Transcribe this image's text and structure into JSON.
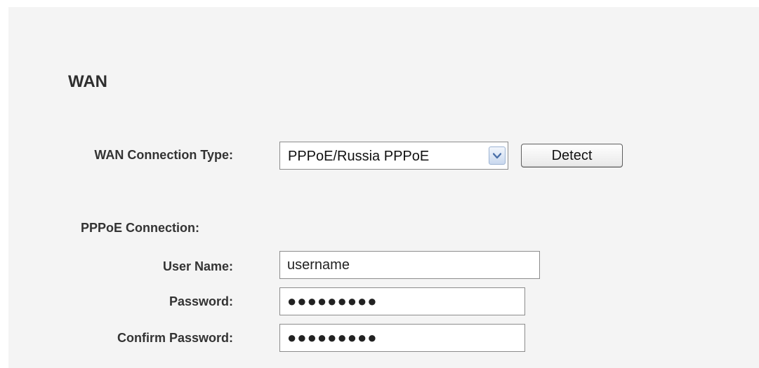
{
  "page": {
    "title": "WAN"
  },
  "wan": {
    "connection_type_label": "WAN Connection Type:",
    "connection_type_value": "PPPoE/Russia PPPoE",
    "detect_button": "Detect"
  },
  "pppoe": {
    "section_label": "PPPoE Connection:",
    "username_label": "User Name:",
    "username_value": "username",
    "password_label": "Password:",
    "password_value": "●●●●●●●●●",
    "confirm_password_label": "Confirm Password:",
    "confirm_password_value": "●●●●●●●●●"
  },
  "colors": {
    "panel_background": "#f4f4f4",
    "label_text": "#333333",
    "select_arrow_accent": "#4a6fa8"
  },
  "icons": {
    "select_arrow": "chevron-down-icon"
  }
}
